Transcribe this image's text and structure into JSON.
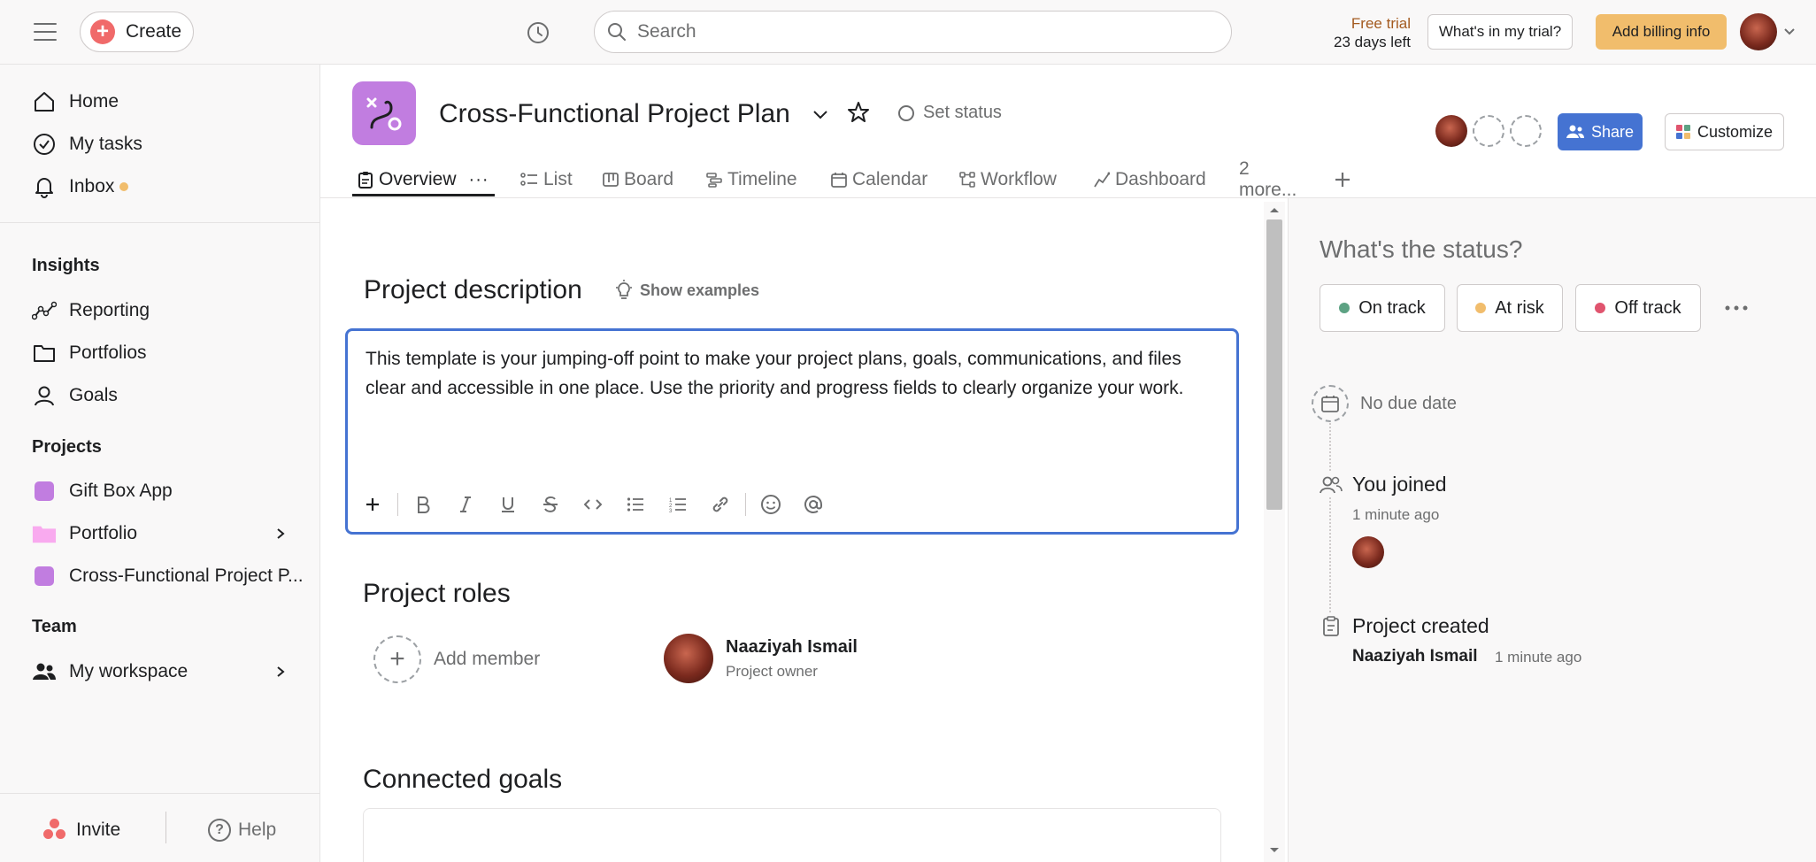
{
  "topbar": {
    "create_label": "Create",
    "search_placeholder": "Search",
    "trial_line1": "Free trial",
    "trial_line2": "23 days left",
    "whats_in_trial": "What's in my trial?",
    "add_billing": "Add billing info"
  },
  "sidebar": {
    "nav": [
      {
        "label": "Home",
        "icon": "home-icon"
      },
      {
        "label": "My tasks",
        "icon": "check-circle-icon"
      },
      {
        "label": "Inbox",
        "icon": "bell-icon"
      }
    ],
    "insights_title": "Insights",
    "insights": [
      {
        "label": "Reporting",
        "icon": "reporting-icon"
      },
      {
        "label": "Portfolios",
        "icon": "folder-icon"
      },
      {
        "label": "Goals",
        "icon": "person-icon"
      }
    ],
    "projects_title": "Projects",
    "projects": [
      {
        "label": "Gift Box App"
      },
      {
        "label": "Portfolio"
      },
      {
        "label": "Cross-Functional Project P..."
      }
    ],
    "team_title": "Team",
    "team": [
      {
        "label": "My workspace"
      }
    ],
    "invite": "Invite",
    "help": "Help"
  },
  "project": {
    "title": "Cross-Functional Project Plan",
    "set_status": "Set status",
    "share": "Share",
    "customize": "Customize",
    "tabs": [
      "Overview",
      "List",
      "Board",
      "Timeline",
      "Calendar",
      "Workflow",
      "Dashboard",
      "2 more..."
    ]
  },
  "main": {
    "description_heading": "Project description",
    "show_examples": "Show examples",
    "description_text": "This template is your jumping-off point to make your project plans, goals, communications, and files clear and accessible in one place. Use the priority and progress fields to clearly organize your work.",
    "roles_heading": "Project roles",
    "add_member": "Add member",
    "owner_name": "Naaziyah Ismail",
    "owner_role": "Project owner",
    "goals_heading": "Connected goals"
  },
  "status_panel": {
    "title": "What's the status?",
    "buttons": [
      {
        "label": "On track",
        "color": "#5da283"
      },
      {
        "label": "At risk",
        "color": "#f1bd6c"
      },
      {
        "label": "Off track",
        "color": "#e0546e"
      }
    ],
    "due": "No due date",
    "joined_title": "You joined",
    "joined_time": "1 minute ago",
    "created_title": "Project created",
    "created_by": "Naaziyah Ismail",
    "created_time": "1 minute ago"
  },
  "colors": {
    "accent": "#4573d2",
    "project": "#c17de0",
    "billing": "#f1bd6c",
    "create": "#f06a6a"
  }
}
